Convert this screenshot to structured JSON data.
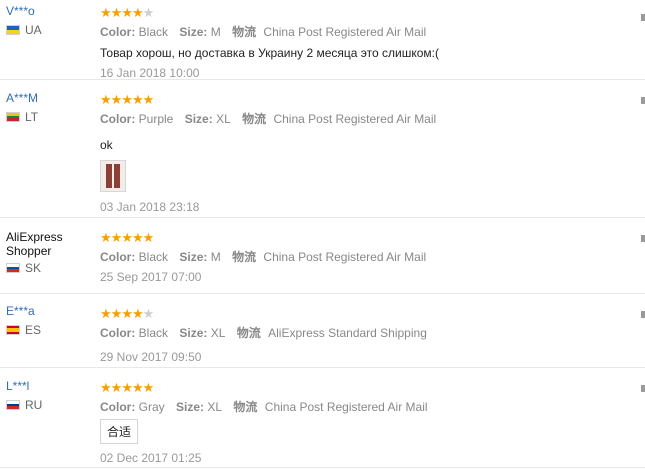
{
  "reviews": [
    {
      "user": "V***o",
      "country": "UA",
      "flag": [
        "#1f5fbf",
        "#f2d51b"
      ],
      "rating": 4,
      "color_label": "Color:",
      "color_value": "Black",
      "size_label": "Size:",
      "size_value": "M",
      "ship_label": "物流",
      "ship_value": "China Post Registered Air Mail",
      "feedback": "Товар хорош, но доставка в Украину 2 месяца это слишком:(",
      "date": "16 Jan 2018 10:00"
    },
    {
      "user": "A***M",
      "country": "LT",
      "flag": [
        "#f1c21b",
        "#0b8a3f",
        "#c1272d"
      ],
      "rating": 5,
      "color_label": "Color:",
      "color_value": "Purple",
      "size_label": "Size:",
      "size_value": "XL",
      "ship_label": "物流",
      "ship_value": "China Post Registered Air Mail",
      "feedback": "ok",
      "date": "03 Jan 2018 23:18"
    },
    {
      "user": "AliExpress Shopper",
      "country": "SK",
      "flag": [
        "#ffffff",
        "#0b4ea2",
        "#d52b1e"
      ],
      "rating": 5,
      "color_label": "Color:",
      "color_value": "Black",
      "size_label": "Size:",
      "size_value": "M",
      "ship_label": "物流",
      "ship_value": "China Post Registered Air Mail",
      "feedback": "",
      "date": "25 Sep 2017 07:00"
    },
    {
      "user": "E***a",
      "country": "ES",
      "flag": [
        "#c60b1e",
        "#ffc400",
        "#c60b1e"
      ],
      "rating": 4,
      "color_label": "Color:",
      "color_value": "Black",
      "size_label": "Size:",
      "size_value": "XL",
      "ship_label": "物流",
      "ship_value": "AliExpress Standard Shipping",
      "feedback": "",
      "date": "29 Nov 2017 09:50"
    },
    {
      "user": "L***l",
      "country": "RU",
      "flag": [
        "#ffffff",
        "#0039a6",
        "#d52b1e"
      ],
      "rating": 5,
      "color_label": "Color:",
      "color_value": "Gray",
      "size_label": "Size:",
      "size_value": "XL",
      "ship_label": "物流",
      "ship_value": "China Post Registered Air Mail",
      "feedback": "合适",
      "date": "02 Dec 2017 01:25"
    }
  ],
  "colors": {
    "link": "#2e6fb5",
    "star": "#f7a000",
    "star_off": "#cfcfcf"
  }
}
